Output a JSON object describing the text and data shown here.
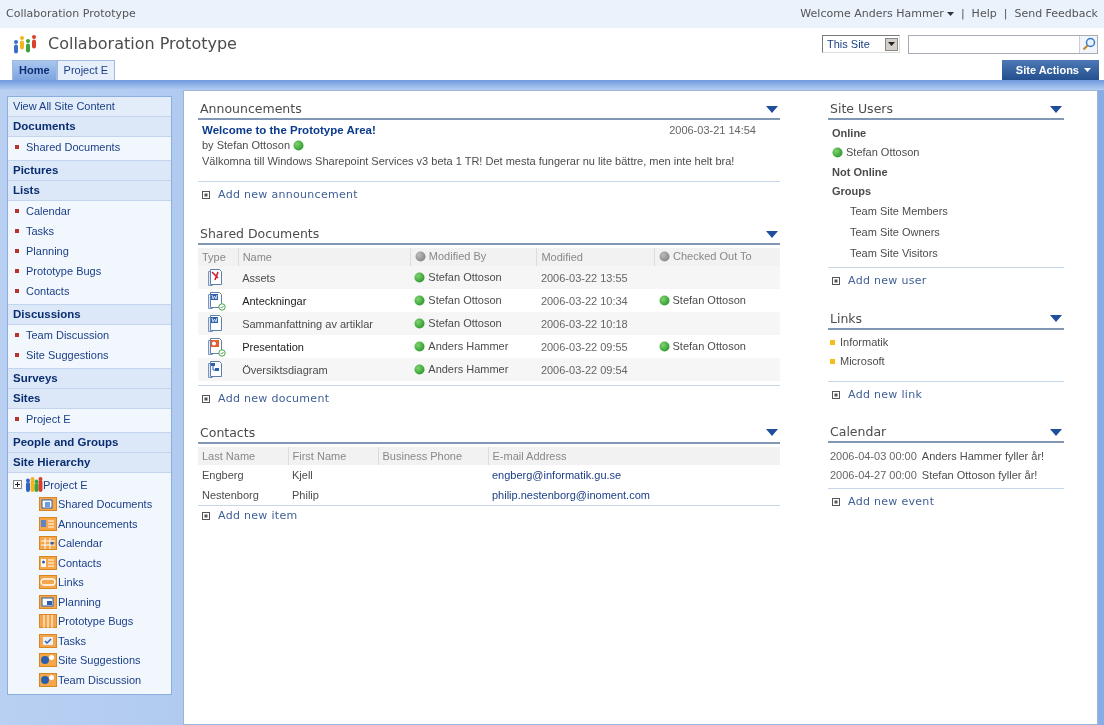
{
  "top_bar": {
    "site_name": "Collaboration Prototype",
    "welcome": "Welcome Anders Hammer",
    "links": [
      "Help",
      "Send Feedback"
    ],
    "separator": "|"
  },
  "header": {
    "title": "Collaboration Prototype",
    "scope": "This Site"
  },
  "tabs": [
    {
      "label": "Home",
      "selected": true
    },
    {
      "label": "Project E",
      "selected": false
    }
  ],
  "site_actions": "Site Actions",
  "quick_launch": {
    "view_all": "View All Site Content",
    "sections": [
      {
        "heading": "Documents",
        "items": [
          "Shared Documents"
        ]
      },
      {
        "heading": "Pictures"
      },
      {
        "heading": "Lists",
        "items": [
          "Calendar",
          "Tasks",
          "Planning",
          "Prototype Bugs",
          "Contacts"
        ]
      },
      {
        "heading": "Discussions",
        "items": [
          "Team Discussion",
          "Site Suggestions"
        ]
      },
      {
        "heading": "Surveys"
      },
      {
        "heading": "Sites",
        "items": [
          "Project E"
        ]
      },
      {
        "heading": "People and Groups"
      }
    ]
  },
  "site_hierarchy": {
    "heading": "Site Hierarchy",
    "site": {
      "label": "Project E",
      "expanded": false
    },
    "items": [
      {
        "label": "Shared Documents",
        "kind": "library"
      },
      {
        "label": "Announcements",
        "kind": "announcements"
      },
      {
        "label": "Calendar",
        "kind": "calendar"
      },
      {
        "label": "Contacts",
        "kind": "contacts"
      },
      {
        "label": "Links",
        "kind": "links"
      },
      {
        "label": "Planning",
        "kind": "picture_library"
      },
      {
        "label": "Prototype Bugs",
        "kind": "issues"
      },
      {
        "label": "Tasks",
        "kind": "tasks"
      },
      {
        "label": "Site Suggestions",
        "kind": "discussion"
      },
      {
        "label": "Team Discussion",
        "kind": "discussion"
      }
    ]
  },
  "announcements": {
    "title": "Announcements",
    "items": [
      {
        "title": "Welcome to the Prototype Area!",
        "by": "by",
        "author": "Stefan Ottoson",
        "date": "2006-03-21 14:54",
        "body": "Välkomna till Windows Sharepoint Services v3 beta 1 TR! Det mesta fungerar nu lite bättre, men inte helt bra!"
      }
    ],
    "add_link": "Add new announcement"
  },
  "shared_documents": {
    "title": "Shared Documents",
    "columns": [
      {
        "label": "Type",
        "presence_icon": false
      },
      {
        "label": "Name",
        "presence_icon": false
      },
      {
        "label": "Modified By",
        "presence_icon": true
      },
      {
        "label": "Modified",
        "presence_icon": false
      },
      {
        "label": "Checked Out To",
        "presence_icon": true
      }
    ],
    "rows": [
      {
        "kind": "pdf",
        "checked_out": false,
        "name": "Assets",
        "modified_by": "Stefan Ottoson",
        "modified": "2006-03-22 13:55"
      },
      {
        "kind": "word",
        "checked_out": true,
        "name": "Anteckningar",
        "modified_by": "Stefan Ottoson",
        "modified": "2006-03-22 10:34",
        "checked_out_to": "Stefan Ottoson"
      },
      {
        "kind": "word",
        "checked_out": false,
        "name": "Sammanfattning av artiklar",
        "modified_by": "Stefan Ottoson",
        "modified": "2006-03-22 10:18"
      },
      {
        "kind": "powerpoint",
        "checked_out": true,
        "name": "Presentation",
        "modified_by": "Anders Hammer",
        "modified": "2006-03-22 09:55",
        "checked_out_to": "Stefan Ottoson"
      },
      {
        "kind": "visio",
        "checked_out": false,
        "name": "Översiktsdiagram",
        "modified_by": "Anders Hammer",
        "modified": "2006-03-22 09:54"
      }
    ],
    "add_link": "Add new document"
  },
  "contacts": {
    "title": "Contacts",
    "columns": [
      "Last Name",
      "First Name",
      "Business Phone",
      "E-mail Address"
    ],
    "rows": [
      {
        "last_name": "Engberg",
        "first_name": "Kjell",
        "email": "engberg@informatik.gu.se"
      },
      {
        "last_name": "Nestenborg",
        "first_name": "Philip",
        "email": "philip.nestenborg@inoment.com"
      }
    ],
    "add_link": "Add new item"
  },
  "site_users": {
    "title": "Site Users",
    "online_label": "Online",
    "online": [
      "Stefan Ottoson"
    ],
    "not_online_label": "Not Online",
    "groups_label": "Groups",
    "groups": [
      "Team Site Members",
      "Team Site Owners",
      "Team Site Visitors"
    ],
    "add_link": "Add new user"
  },
  "links": {
    "title": "Links",
    "items": [
      "Informatik",
      "Microsoft"
    ],
    "add_link": "Add new link"
  },
  "calendar": {
    "title": "Calendar",
    "events": [
      {
        "date": "2006-04-03 00:00",
        "title": "Anders Hammer fyller år!"
      },
      {
        "date": "2006-04-27 00:00",
        "title": "Stefan Ottoson fyller år!"
      }
    ],
    "add_link": "Add new event"
  }
}
